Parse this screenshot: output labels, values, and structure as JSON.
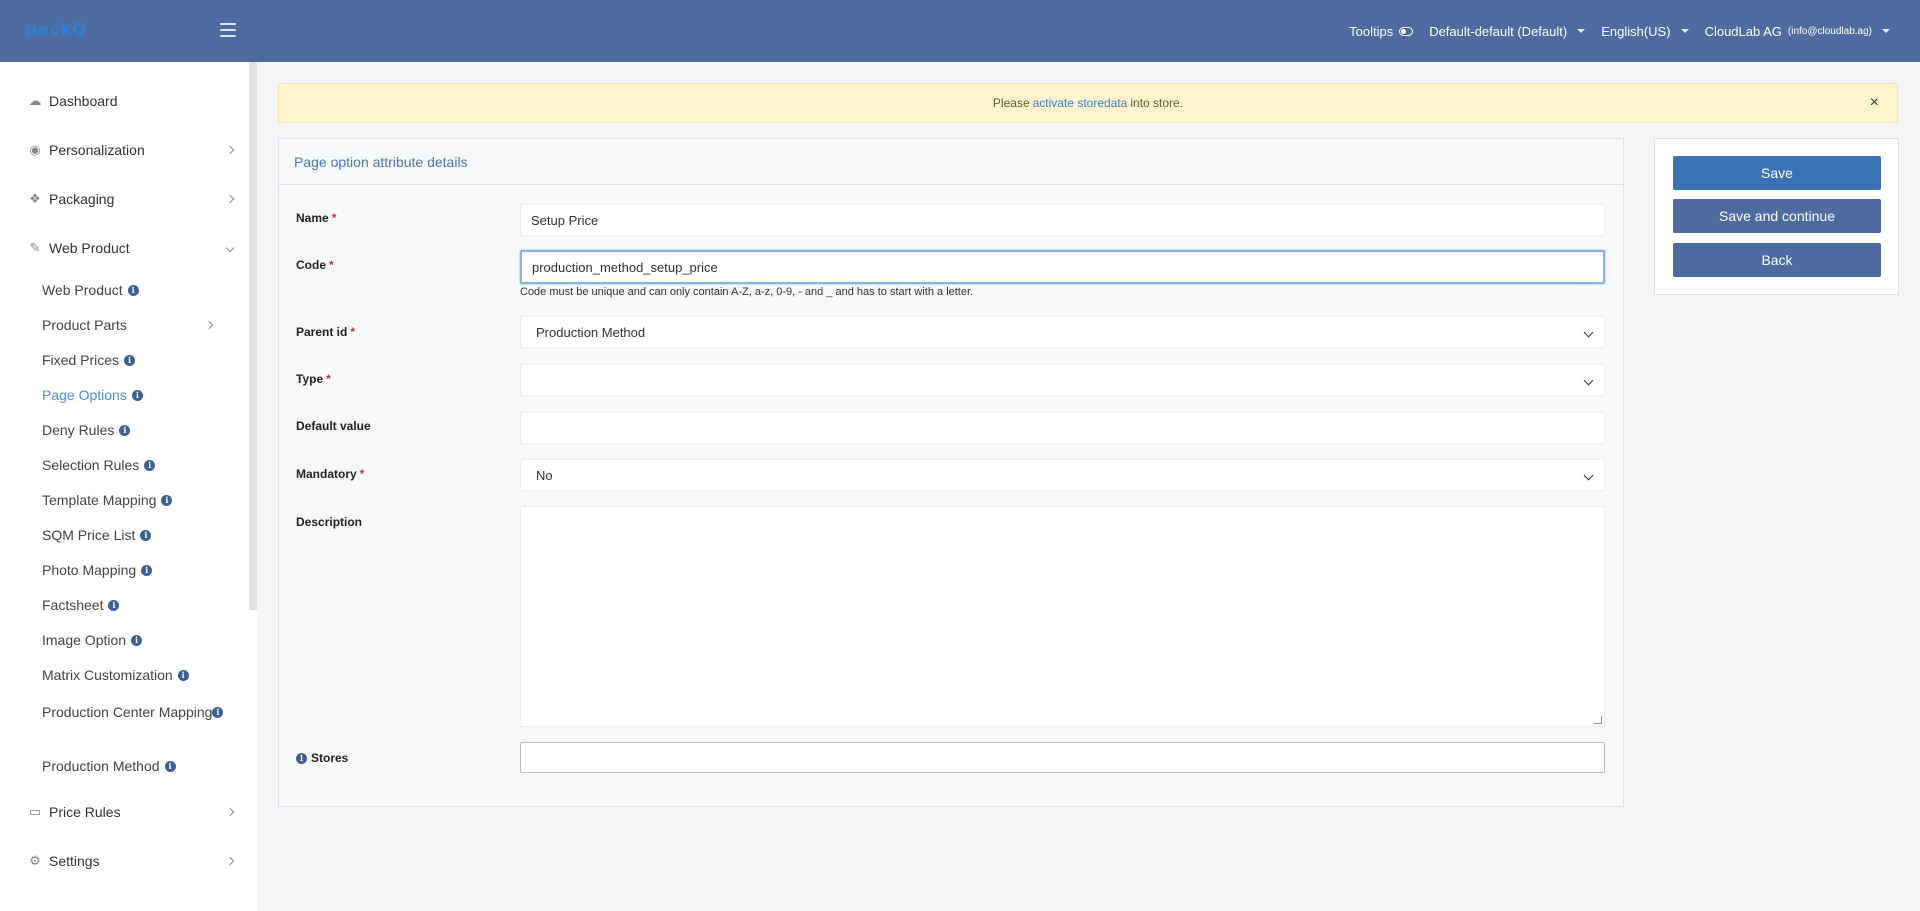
{
  "app": {
    "logo": "packQ"
  },
  "topbar": {
    "tooltips_label": "Tooltips",
    "store_select": "Default-default (Default)",
    "language": "English(US)",
    "account_name": "CloudLab AG",
    "account_email": "(info@cloudlab.ag)"
  },
  "sidebar": {
    "items": [
      {
        "label": "Dashboard",
        "icon": "cloud-icon"
      },
      {
        "label": "Personalization",
        "icon": "eye-icon"
      },
      {
        "label": "Packaging",
        "icon": "dropbox-icon"
      },
      {
        "label": "Web Product",
        "icon": "wand-icon"
      },
      {
        "label": "Price Rules",
        "icon": "money-icon"
      },
      {
        "label": "Settings",
        "icon": "gears-icon"
      }
    ],
    "web_product_children": [
      "Web Product",
      "Product Parts",
      "Fixed Prices",
      "Page Options",
      "Deny Rules",
      "Selection Rules",
      "Template Mapping",
      "SQM Price List",
      "Photo Mapping",
      "Factsheet",
      "Image Option",
      "Matrix Customization",
      "Production Center Mapping",
      "Production Method"
    ],
    "active_child": "Page Options"
  },
  "alert": {
    "prefix": "Please",
    "link": "activate storedata",
    "suffix": "into store.",
    "close": "×"
  },
  "form": {
    "title": "Page option attribute details",
    "name_label": "Name",
    "name_value": "Setup Price",
    "code_label": "Code",
    "code_value": "production_method_setup_price",
    "code_helper": "Code must be unique and can only contain A-Z, a-z, 0-9, - and _ and has to start with a letter.",
    "parent_label": "Parent id",
    "parent_value": "Production Method",
    "type_label": "Type",
    "type_value": "",
    "default_label": "Default value",
    "default_value": "",
    "mandatory_label": "Mandatory",
    "mandatory_value": "No",
    "description_label": "Description",
    "stores_label": "Stores",
    "required_mark": "*"
  },
  "actions": {
    "save": "Save",
    "save_continue": "Save and continue",
    "back": "Back"
  },
  "colors": {
    "topbar": "#4d6b9f",
    "primary_button": "#3a72b5",
    "secondary_button": "#4d6b9f",
    "active_link": "#4a90d9",
    "alert_bg": "#fdf4cf"
  }
}
